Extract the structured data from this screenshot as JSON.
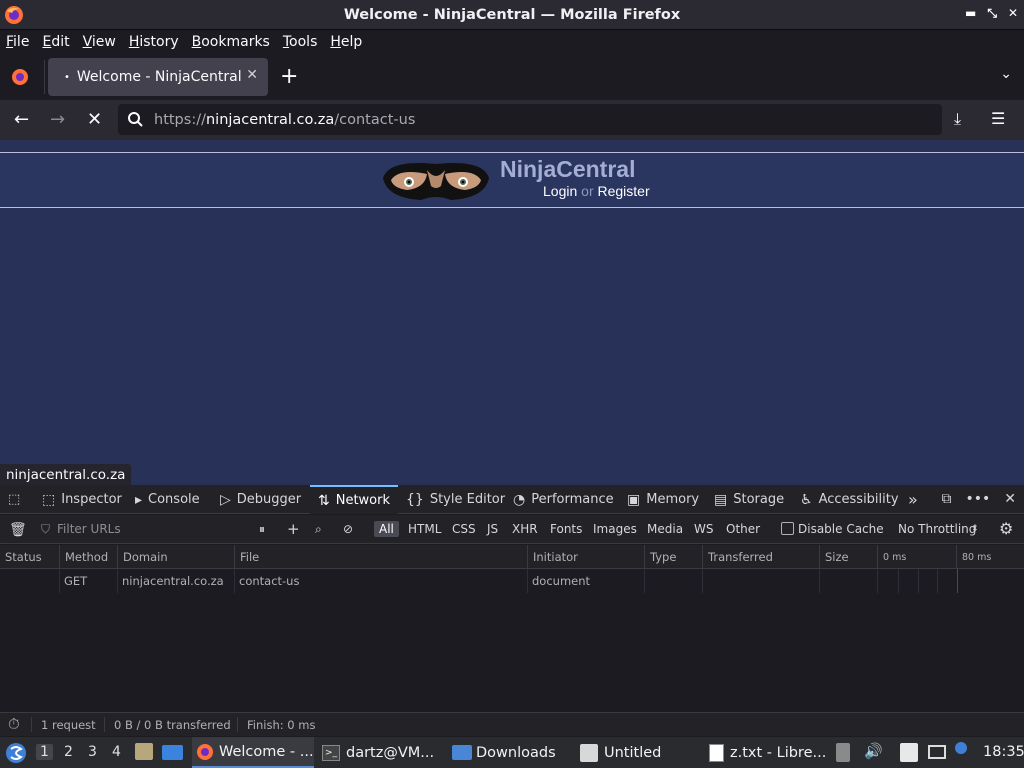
{
  "window": {
    "title": "Welcome - NinjaCentral — Mozilla Firefox"
  },
  "menu": [
    "File",
    "Edit",
    "View",
    "History",
    "Bookmarks",
    "Tools",
    "Help"
  ],
  "tab": {
    "title": "Welcome - NinjaCentral"
  },
  "urlbar": {
    "prefix": "https://",
    "domain": "ninjacentral.co.za",
    "path": "/contact-us"
  },
  "page": {
    "brand": "NinjaCentral",
    "login": "Login",
    "or": "or",
    "register": "Register",
    "status_url": "ninjacentral.co.za"
  },
  "devtools": {
    "tabs": [
      "Inspector",
      "Console",
      "Debugger",
      "Network",
      "Style Editor",
      "Performance",
      "Memory",
      "Storage",
      "Accessibility"
    ],
    "selected_tab": "Network",
    "filter_placeholder": "Filter URLs",
    "type_filters": [
      "All",
      "HTML",
      "CSS",
      "JS",
      "XHR",
      "Fonts",
      "Images",
      "Media",
      "WS",
      "Other"
    ],
    "disable_cache": "Disable Cache",
    "throttling": "No Throttling",
    "columns": [
      "Status",
      "Method",
      "Domain",
      "File",
      "Initiator",
      "Type",
      "Transferred",
      "Size"
    ],
    "timeline": [
      "0 ms",
      "80 ms"
    ],
    "requests": [
      {
        "status": "",
        "method": "GET",
        "domain": "ninjacentral.co.za",
        "file": "contact-us",
        "initiator": "document",
        "type": "",
        "transferred": "",
        "size": ""
      }
    ],
    "summary": {
      "requests": "1 request",
      "transferred": "0 B / 0 B transferred",
      "finish": "Finish: 0 ms"
    }
  },
  "taskbar": {
    "workspaces": [
      "1",
      "2",
      "3",
      "4"
    ],
    "windows": [
      "Welcome - ...",
      "dartz@VM...",
      "Downloads",
      "Untitled",
      "z.txt - Libre..."
    ],
    "clock": "18:35"
  },
  "colors": {
    "page_bg": "#283158",
    "brand": "#a5add2",
    "accent": "#75bfff"
  }
}
